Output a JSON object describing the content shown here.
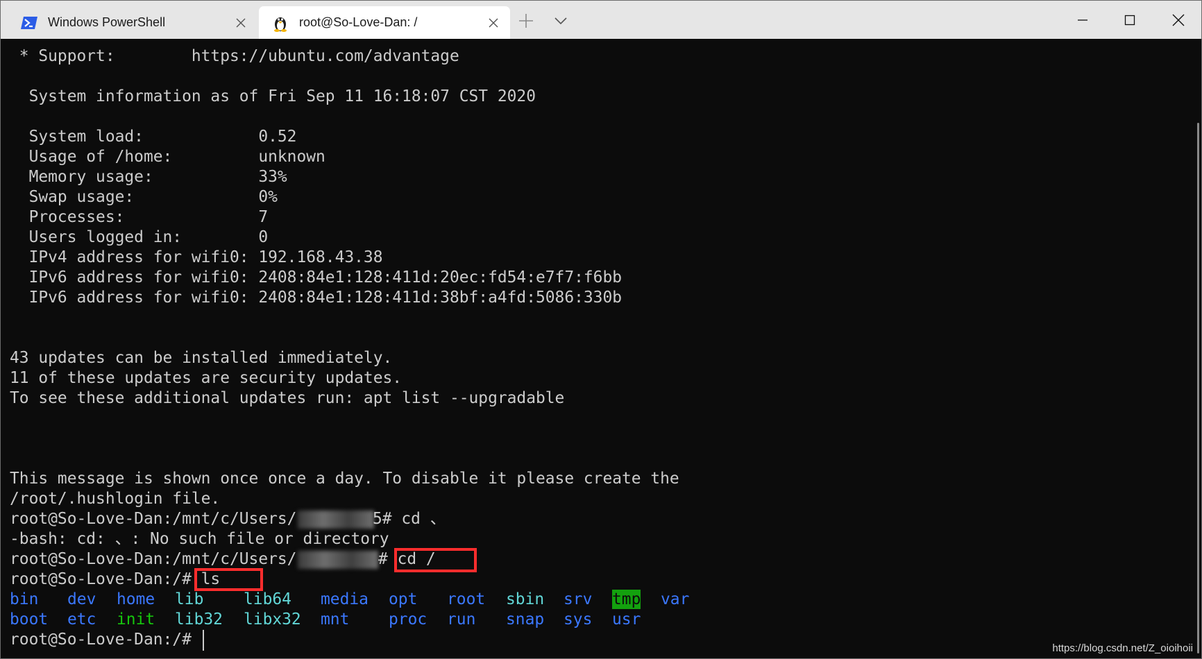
{
  "titlebar": {
    "tabs": [
      {
        "label": "Windows PowerShell",
        "icon": "powershell-icon",
        "active": false
      },
      {
        "label": "root@So-Love-Dan: /",
        "icon": "linux-penguin-icon",
        "active": true
      }
    ],
    "new_tab_icon": "plus-icon",
    "dropdown_icon": "chevron-down-icon",
    "window_controls": [
      "minimize-icon",
      "maximize-icon",
      "close-icon"
    ]
  },
  "terminal": {
    "motd": {
      "support": " * Support:        https://ubuntu.com/advantage",
      "sysinfo_header": "  System information as of Fri Sep 11 16:18:07 CST 2020",
      "stats": [
        "  System load:            0.52",
        "  Usage of /home:         unknown",
        "  Memory usage:           33%",
        "  Swap usage:             0%",
        "  Processes:              7",
        "  Users logged in:        0",
        "  IPv4 address for wifi0: 192.168.43.38",
        "  IPv6 address for wifi0: 2408:84e1:128:411d:20ec:fd54:e7f7:f6bb",
        "  IPv6 address for wifi0: 2408:84e1:128:411d:38bf:a4fd:5086:330b"
      ],
      "updates": [
        "43 updates can be installed immediately.",
        "11 of these updates are security updates.",
        "To see these additional updates run: apt list --upgradable"
      ],
      "hush": [
        "This message is shown once once a day. To disable it please create the",
        "/root/.hushlogin file."
      ]
    },
    "session": {
      "prompt_prefix": "root@So-Love-Dan:/mnt/c/Users/",
      "line1_suffix": "5# cd 、",
      "line2": "-bash: cd: 、: No such file or directory",
      "line3_suffix": "# cd /",
      "prompt_root_ls": "root@So-Love-Dan:/# ls",
      "prompt_root_final": "root@So-Love-Dan:/# "
    },
    "ls_output": {
      "row1": [
        "bin",
        "dev",
        "home",
        "lib",
        "lib64",
        "media",
        "opt",
        "root",
        "sbin",
        "srv",
        "tmp",
        "var"
      ],
      "row2": [
        "boot",
        "etc",
        "init",
        "lib32",
        "libx32",
        "mnt",
        "proc",
        "run",
        "snap",
        "sys",
        "usr"
      ]
    },
    "colors": {
      "background": "#0c0c0c",
      "foreground": "#cccccc",
      "directory_blue": "#3b78ff",
      "symlink_cyan": "#61d6d6",
      "executable_green": "#16c60c",
      "sticky_dir_bg": "#13a10e",
      "highlight_box": "#ff2d2d"
    }
  },
  "watermark": "https://blog.csdn.net/Z_oioihoii"
}
